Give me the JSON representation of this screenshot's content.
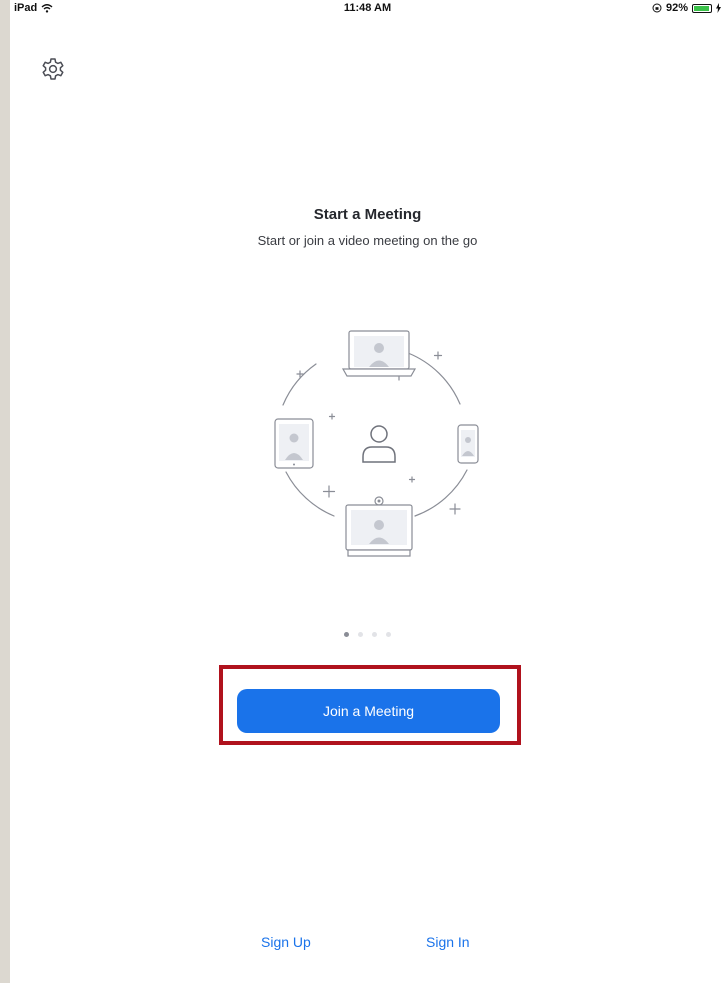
{
  "status_bar": {
    "device": "iPad",
    "time": "11:48 AM",
    "battery": "92%",
    "battery_level": 0.92
  },
  "icons": {
    "settings": "gear-icon",
    "wifi": "wifi-icon",
    "orientation_lock": "orientation-lock-icon",
    "battery": "battery-icon",
    "charging": "charging-bolt-icon"
  },
  "onboarding": {
    "title": "Start a Meeting",
    "subtitle": "Start or join a video meeting on the go",
    "page_count": 4,
    "current_page": 1
  },
  "actions": {
    "join_label": "Join a Meeting",
    "sign_up_label": "Sign Up",
    "sign_in_label": "Sign In"
  },
  "colors": {
    "accent": "#1a73ea",
    "highlight": "#b0121d",
    "illustration_stroke": "#8a8d96"
  }
}
